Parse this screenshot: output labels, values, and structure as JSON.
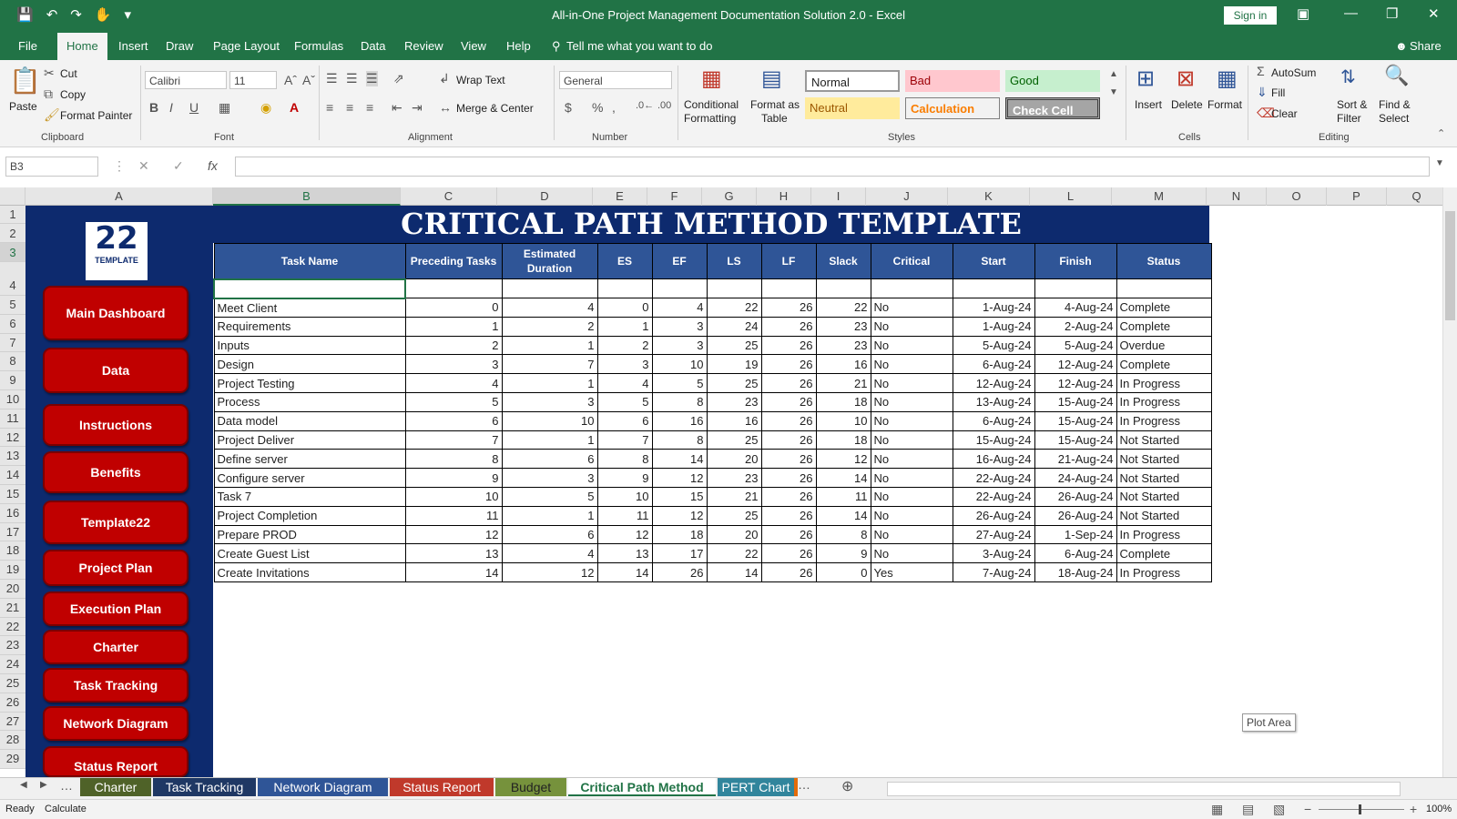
{
  "app": {
    "title": "All-in-One Project Management Documentation Solution 2.0  -  Excel",
    "signin": "Sign in",
    "share": "Share"
  },
  "menu_tabs": [
    "File",
    "Home",
    "Insert",
    "Draw",
    "Page Layout",
    "Formulas",
    "Data",
    "Review",
    "View",
    "Help"
  ],
  "tell_me": "Tell me what you want to do",
  "ribbon": {
    "clipboard": {
      "paste": "Paste",
      "cut": "Cut",
      "copy": "Copy",
      "format_painter": "Format Painter",
      "group": "Clipboard"
    },
    "font": {
      "name": "Calibri",
      "size": "11",
      "group": "Font"
    },
    "alignment": {
      "wrap_text": "Wrap Text",
      "merge_center": "Merge & Center",
      "group": "Alignment"
    },
    "number": {
      "format": "General",
      "currency": "$",
      "percent": "%",
      "group": "Number"
    },
    "styles": {
      "conditional": "Conditional",
      "conditional2": "Formatting",
      "format_as": "Format as",
      "format_as2": "Table",
      "normal": "Normal",
      "bad": "Bad",
      "good": "Good",
      "neutral": "Neutral",
      "calculation": "Calculation",
      "check_cell": "Check Cell",
      "group": "Styles"
    },
    "cells": {
      "insert": "Insert",
      "delete": "Delete",
      "format": "Format",
      "group": "Cells"
    },
    "editing": {
      "autosum": "AutoSum",
      "fill": "Fill",
      "clear": "Clear",
      "sort": "Sort &",
      "sort2": "Filter",
      "find": "Find &",
      "find2": "Select",
      "group": "Editing"
    }
  },
  "formula_bar": {
    "name_box": "B3",
    "fx": "fx",
    "formula": ""
  },
  "columns": [
    "A",
    "B",
    "C",
    "D",
    "E",
    "F",
    "G",
    "H",
    "I",
    "J",
    "K",
    "L",
    "M",
    "N",
    "O",
    "P",
    "Q"
  ],
  "rows": [
    "1",
    "2",
    "3",
    "4",
    "5",
    "6",
    "7",
    "8",
    "9",
    "10",
    "11",
    "12",
    "13",
    "14",
    "15",
    "16",
    "17",
    "18",
    "19",
    "20",
    "21",
    "22",
    "23",
    "24",
    "25",
    "26",
    "27",
    "28",
    "29"
  ],
  "logo": {
    "number": "22",
    "text": "TEMPLATE"
  },
  "nav_buttons": [
    "Main Dashboard",
    "Data",
    "Instructions",
    "Benefits",
    "Template22",
    "Project Plan",
    "Execution Plan",
    "Charter",
    "Task Tracking",
    "Network Diagram",
    "Status Report"
  ],
  "banner_title": "CRITICAL PATH METHOD TEMPLATE",
  "table": {
    "headers": [
      "Task Name",
      "Preceding Tasks",
      "Estimated Duration",
      "ES",
      "EF",
      "LS",
      "LF",
      "Slack",
      "Critical",
      "Start",
      "Finish",
      "Status"
    ],
    "rows": [
      [
        "Meet Client",
        "0",
        "4",
        "0",
        "4",
        "22",
        "26",
        "22",
        "No",
        "1-Aug-24",
        "4-Aug-24",
        "Complete"
      ],
      [
        "Requirements",
        "1",
        "2",
        "1",
        "3",
        "24",
        "26",
        "23",
        "No",
        "1-Aug-24",
        "2-Aug-24",
        "Complete"
      ],
      [
        "Inputs",
        "2",
        "1",
        "2",
        "3",
        "25",
        "26",
        "23",
        "No",
        "5-Aug-24",
        "5-Aug-24",
        "Overdue"
      ],
      [
        "Design",
        "3",
        "7",
        "3",
        "10",
        "19",
        "26",
        "16",
        "No",
        "6-Aug-24",
        "12-Aug-24",
        "Complete"
      ],
      [
        "Project Testing",
        "4",
        "1",
        "4",
        "5",
        "25",
        "26",
        "21",
        "No",
        "12-Aug-24",
        "12-Aug-24",
        "In Progress"
      ],
      [
        "Process",
        "5",
        "3",
        "5",
        "8",
        "23",
        "26",
        "18",
        "No",
        "13-Aug-24",
        "15-Aug-24",
        "In Progress"
      ],
      [
        "Data model",
        "6",
        "10",
        "6",
        "16",
        "16",
        "26",
        "10",
        "No",
        "6-Aug-24",
        "15-Aug-24",
        "In Progress"
      ],
      [
        "Project Deliver",
        "7",
        "1",
        "7",
        "8",
        "25",
        "26",
        "18",
        "No",
        "15-Aug-24",
        "15-Aug-24",
        "Not Started"
      ],
      [
        "Define server",
        "8",
        "6",
        "8",
        "14",
        "20",
        "26",
        "12",
        "No",
        "16-Aug-24",
        "21-Aug-24",
        "Not Started"
      ],
      [
        "Configure server",
        "9",
        "3",
        "9",
        "12",
        "23",
        "26",
        "14",
        "No",
        "22-Aug-24",
        "24-Aug-24",
        "Not Started"
      ],
      [
        "Task 7",
        "10",
        "5",
        "10",
        "15",
        "21",
        "26",
        "11",
        "No",
        "22-Aug-24",
        "26-Aug-24",
        "Not Started"
      ],
      [
        "Project Completion",
        "11",
        "1",
        "11",
        "12",
        "25",
        "26",
        "14",
        "No",
        "26-Aug-24",
        "26-Aug-24",
        "Not Started"
      ],
      [
        "Prepare PROD",
        "12",
        "6",
        "12",
        "18",
        "20",
        "26",
        "8",
        "No",
        "27-Aug-24",
        "1-Sep-24",
        "In Progress"
      ],
      [
        "Create Guest List",
        "13",
        "4",
        "13",
        "17",
        "22",
        "26",
        "9",
        "No",
        "3-Aug-24",
        "6-Aug-24",
        "Complete"
      ],
      [
        "Create Invitations",
        "14",
        "12",
        "14",
        "26",
        "14",
        "26",
        "0",
        "Yes",
        "7-Aug-24",
        "18-Aug-24",
        "In Progress"
      ]
    ]
  },
  "tooltip": "Plot Area",
  "sheet_tabs": [
    {
      "label": "Charter",
      "color": "#4f6228"
    },
    {
      "label": "Task Tracking",
      "color": "#1f3864"
    },
    {
      "label": "Network Diagram",
      "color": "#2f5597"
    },
    {
      "label": "Status Report",
      "color": "#c0392b"
    },
    {
      "label": "Budget",
      "color": "#76923c"
    },
    {
      "label": "Critical Path Method",
      "color": "#ffffff"
    },
    {
      "label": "PERT Chart",
      "color": "#31859c"
    }
  ],
  "status": {
    "ready": "Ready",
    "calculate": "Calculate",
    "zoom": "100%"
  }
}
